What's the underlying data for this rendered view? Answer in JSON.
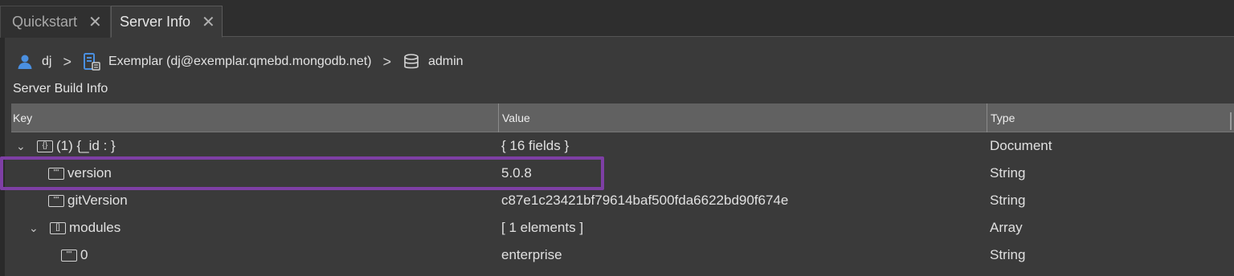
{
  "tabs": [
    {
      "label": "Quickstart",
      "active": false
    },
    {
      "label": "Server Info",
      "active": true
    }
  ],
  "breadcrumb": {
    "user": "dj",
    "connection": "Exemplar (dj@exemplar.qmebd.mongodb.net)",
    "database": "admin"
  },
  "section_title": "Server Build Info",
  "table": {
    "columns": [
      "Key",
      "Value",
      "Type"
    ],
    "rows": [
      {
        "key": "(1) {_id : }",
        "value": "{ 16 fields }",
        "type": "Document",
        "icon": "document-icon",
        "expanded": true
      },
      {
        "key": "version",
        "value": "5.0.8",
        "type": "String",
        "icon": "string-icon",
        "highlighted": true
      },
      {
        "key": "gitVersion",
        "value": "c87e1c23421bf79614baf500fda6622bd90f674e",
        "type": "String",
        "icon": "string-icon"
      },
      {
        "key": "modules",
        "value": "[ 1 elements ]",
        "type": "Array",
        "icon": "array-icon",
        "expanded": true
      },
      {
        "key": "0",
        "value": "enterprise",
        "type": "String",
        "icon": "string-icon"
      }
    ]
  },
  "colors": {
    "highlight": "#7e3fa5",
    "user_icon": "#4a8fe0",
    "connection_icon": "#4a8fe0"
  }
}
